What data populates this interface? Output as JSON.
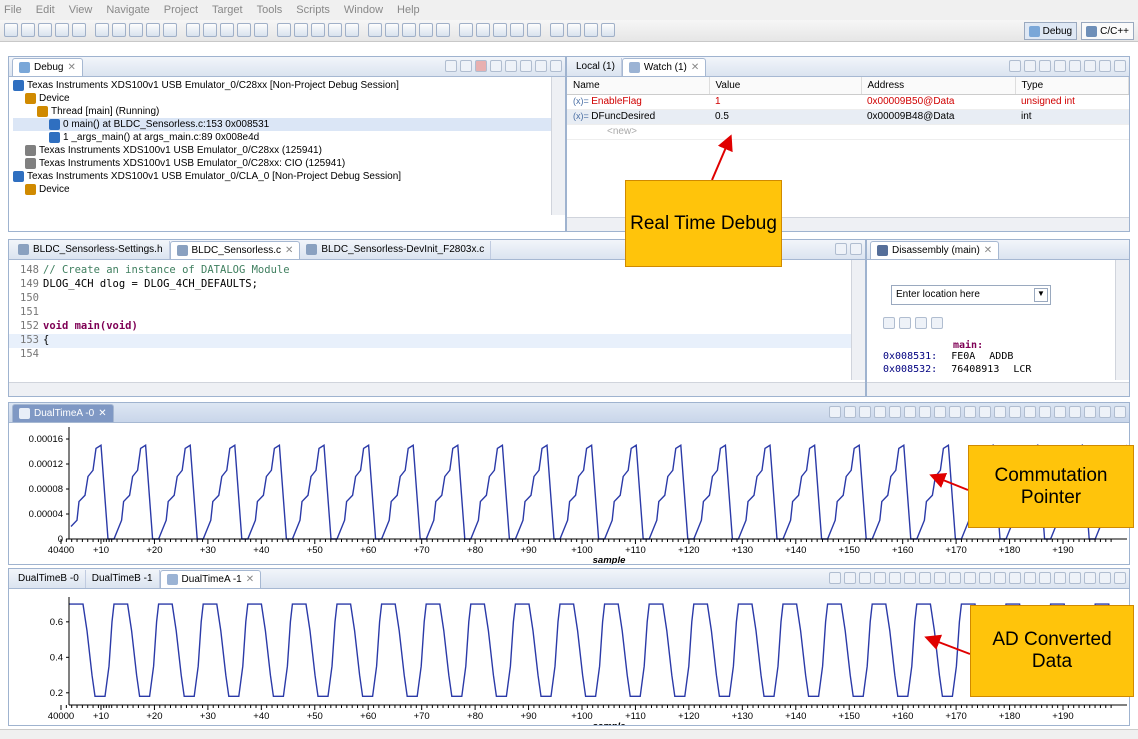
{
  "menu": [
    "File",
    "Edit",
    "View",
    "Navigate",
    "Project",
    "Target",
    "Tools",
    "Scripts",
    "Window",
    "Help"
  ],
  "perspectives": {
    "debug": "Debug",
    "ccpp": "C/C++"
  },
  "debug_view": {
    "tab": "Debug",
    "rows": [
      {
        "indent": 0,
        "text": "Texas Instruments XDS100v1 USB Emulator_0/C28xx [Non-Project Debug Session]",
        "color": "#2f6fc0"
      },
      {
        "indent": 1,
        "text": "Device",
        "color": "#d08a00"
      },
      {
        "indent": 2,
        "text": "Thread [main] (Running)",
        "color": "#d08a00"
      },
      {
        "indent": 3,
        "text": "0 main() at BLDC_Sensorless.c:153 0x008531",
        "color": "#2f6fc0",
        "selected": true
      },
      {
        "indent": 3,
        "text": "1 _args_main() at args_main.c:89 0x008e4d",
        "color": "#2f6fc0"
      },
      {
        "indent": 1,
        "text": "Texas Instruments XDS100v1 USB Emulator_0/C28xx (125941)",
        "color": "#808080"
      },
      {
        "indent": 1,
        "text": "Texas Instruments XDS100v1 USB Emulator_0/C28xx: CIO (125941)",
        "color": "#808080"
      },
      {
        "indent": 0,
        "text": "Texas Instruments XDS100v1 USB Emulator_0/CLA_0 [Non-Project Debug Session]",
        "color": "#2f6fc0"
      },
      {
        "indent": 1,
        "text": "Device",
        "color": "#d08a00"
      }
    ]
  },
  "watch_view": {
    "tabs": [
      "Local (1)",
      "Watch (1)"
    ],
    "columns": [
      "Name",
      "Value",
      "Address",
      "Type"
    ],
    "rows": [
      {
        "name": "EnableFlag",
        "value": "1",
        "address": "0x00009B50@Data",
        "type": "unsigned int",
        "changed": true
      },
      {
        "name": "DFuncDesired",
        "value": "0.5",
        "address": "0x00009B48@Data",
        "type": "int",
        "changed": false
      }
    ],
    "new_row": "<new>"
  },
  "editor": {
    "tabs": [
      "BLDC_Sensorless-Settings.h",
      "BLDC_Sensorless.c",
      "BLDC_Sensorless-DevInit_F2803x.c"
    ],
    "lines": [
      {
        "n": "148",
        "text": "// Create an instance of DATALOG Module",
        "kind": "comment"
      },
      {
        "n": "149",
        "text": "DLOG_4CH dlog = DLOG_4CH_DEFAULTS;",
        "kind": "code"
      },
      {
        "n": "150",
        "text": "",
        "kind": "code"
      },
      {
        "n": "151",
        "text": "",
        "kind": "code"
      },
      {
        "n": "152",
        "text": "void main(void)",
        "kind": "func"
      },
      {
        "n": "153",
        "text": "{",
        "kind": "code",
        "current": true
      },
      {
        "n": "154",
        "text": "",
        "kind": "code"
      }
    ]
  },
  "disassembly": {
    "tab": "Disassembly (main)",
    "location_placeholder": "Enter location here",
    "label": "main:",
    "rows": [
      {
        "addr": "0x008531:",
        "op": "FE0A",
        "mn": "ADDB"
      },
      {
        "addr": "0x008532:",
        "op": "76408913",
        "mn": "LCR"
      }
    ]
  },
  "graph_a": {
    "tab": "DualTimeA -0",
    "y_ticks": [
      "0.00016",
      "0.00012",
      "0.00008",
      "0.00004",
      "0"
    ],
    "x_ticks": [
      "40400",
      "+10",
      "+20",
      "+30",
      "+40",
      "+50",
      "+60",
      "+70",
      "+80",
      "+90",
      "+100",
      "+110",
      "+120",
      "+130",
      "+140",
      "+150",
      "+160",
      "+170",
      "+180",
      "+190"
    ],
    "xlabel": "sample"
  },
  "graph_b": {
    "tabs": [
      "DualTimeB -0",
      "DualTimeB -1",
      "DualTimeA -1"
    ],
    "y_ticks": [
      "0.6",
      "0.4",
      "0.2"
    ],
    "x_ticks": [
      "40000",
      "+10",
      "+20",
      "+30",
      "+40",
      "+50",
      "+60",
      "+70",
      "+80",
      "+90",
      "+100",
      "+110",
      "+120",
      "+130",
      "+140",
      "+150",
      "+160",
      "+170",
      "+180",
      "+190"
    ],
    "xlabel": "sample"
  },
  "callouts": {
    "realtime": "Real Time Debug",
    "commutation": "Commutation Pointer",
    "adc": "AD Converted Data"
  },
  "colors": {
    "trace": "#2b3aa8",
    "callout": "#ffc40b",
    "arrow": "#e00000",
    "accent": "#2f6fc0"
  }
}
